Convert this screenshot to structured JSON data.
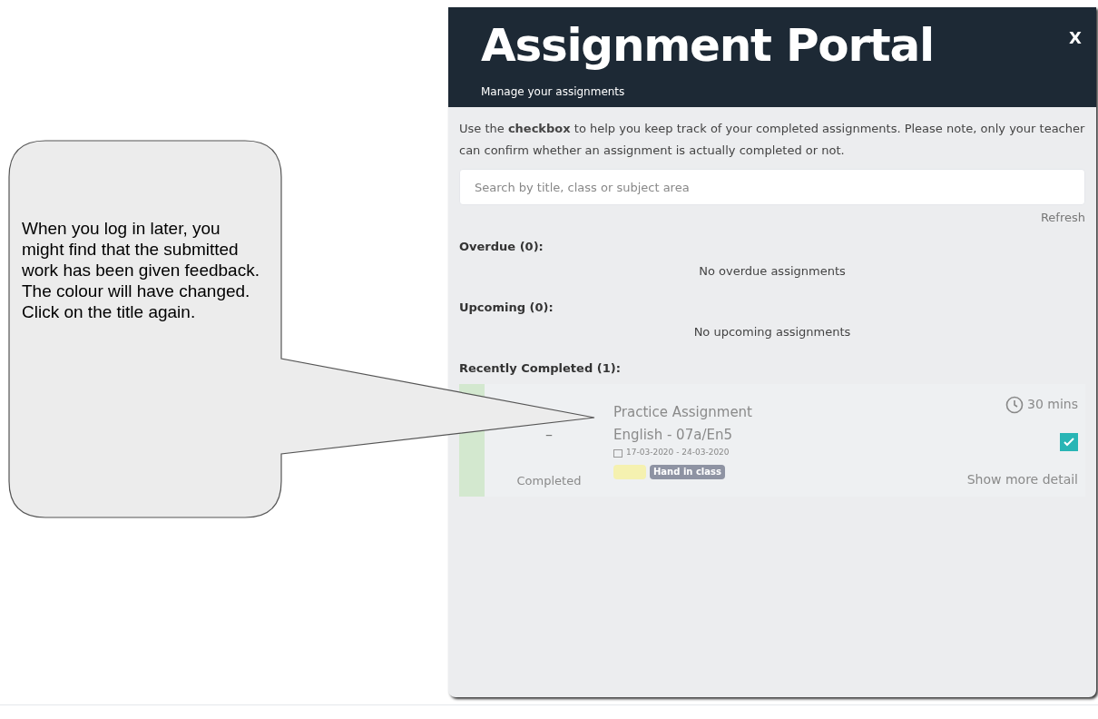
{
  "callout": {
    "text": "When you log in later, you might find that the submitted work has been given feedback. The colour will have changed. Click on the title again."
  },
  "portal": {
    "title": "Assignment Portal",
    "subtitle": "Manage your assignments",
    "close": "X",
    "intro": "Use the **checkbox** to help you keep track of your completed assignments. Please note, only your teacher can confirm whether an assignment is actually completed or not.",
    "search": {
      "placeholder": "Search by title, class or subject area"
    },
    "refresh": "Refresh",
    "sections": [
      {
        "heading": "Overdue (0):",
        "empty": "No overdue assignments"
      },
      {
        "heading": "Upcoming (0):",
        "empty": "No upcoming assignments"
      },
      {
        "heading": "Recently Completed (1):",
        "items": [
          {
            "title": "Practice Assignment",
            "subject": "English - 07a/En5",
            "dates": "17-03-2020 - 24-03-2020",
            "duration": "30 mins",
            "mark": "–",
            "status": "Completed",
            "checked": true,
            "color": "#d3e8cf",
            "tags": [
              {
                "color": "#f5f1b0"
              },
              {
                "label": "Hand in class",
                "color": "#8e93a3"
              }
            ],
            "more": "Show more detail"
          }
        ]
      }
    ]
  }
}
